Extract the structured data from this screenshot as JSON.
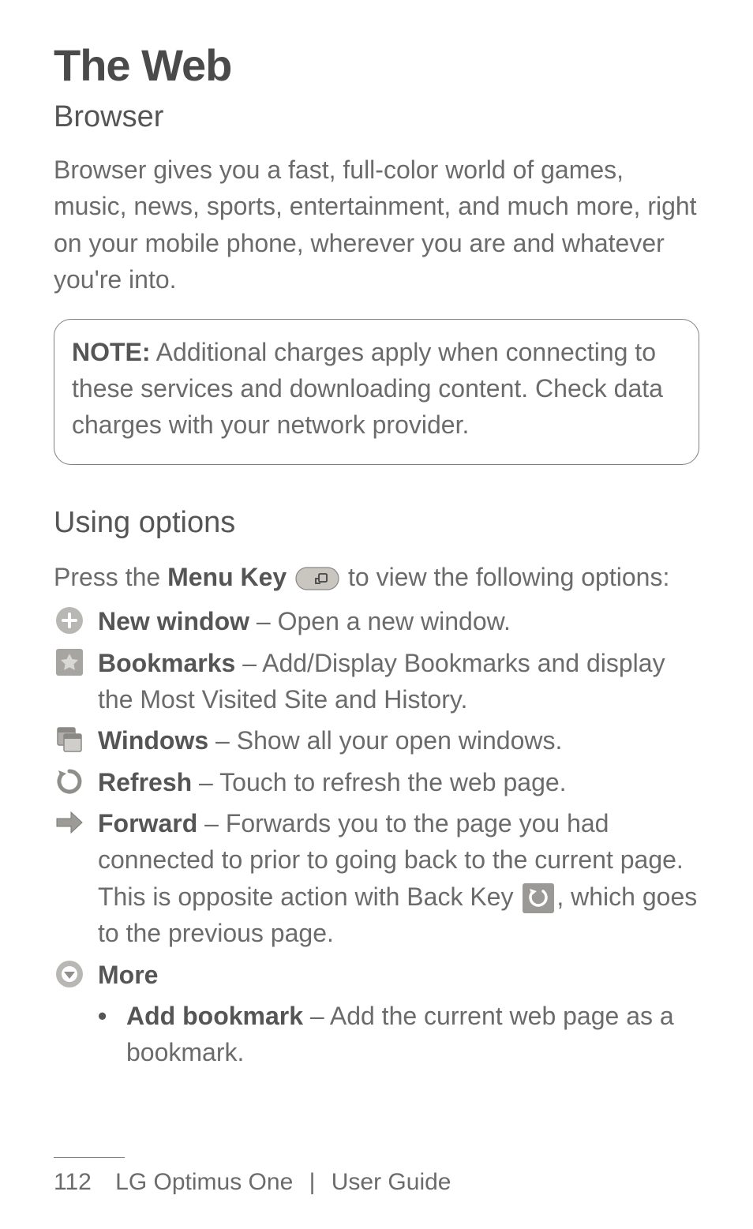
{
  "title": "The Web",
  "subtitle": "Browser",
  "intro": "Browser gives you a fast, full-color world of games, music, news, sports, entertainment, and much more, right on your mobile phone, wherever you are and whatever you're into.",
  "note": {
    "label": "NOTE:",
    "text": "Additional charges apply when connecting to these services and downloading content. Check data charges with your network provider."
  },
  "section": "Using options",
  "options_intro_pre": "Press the ",
  "options_intro_bold": "Menu Key",
  "options_intro_post": " to view the following options:",
  "options": [
    {
      "label": "New window",
      "desc": " – Open a new window."
    },
    {
      "label": "Bookmarks",
      "desc": " – Add/Display Bookmarks and display the Most Visited Site and History."
    },
    {
      "label": "Windows",
      "desc": " – Show all your open windows."
    },
    {
      "label": "Refresh",
      "desc": " – Touch to refresh the web page."
    },
    {
      "label": "Forward",
      "desc_pre": " – Forwards you to the page you had connected to prior to going back to the current page. This is opposite action with Back Key ",
      "desc_post": ", which goes to the previous page."
    },
    {
      "label": "More",
      "desc": ""
    }
  ],
  "more_sub": {
    "label": "Add bookmark",
    "desc": " – Add the current web page as a bookmark."
  },
  "footer": {
    "page": "112",
    "product": "LG Optimus One",
    "sep": "|",
    "doc": "User Guide"
  }
}
